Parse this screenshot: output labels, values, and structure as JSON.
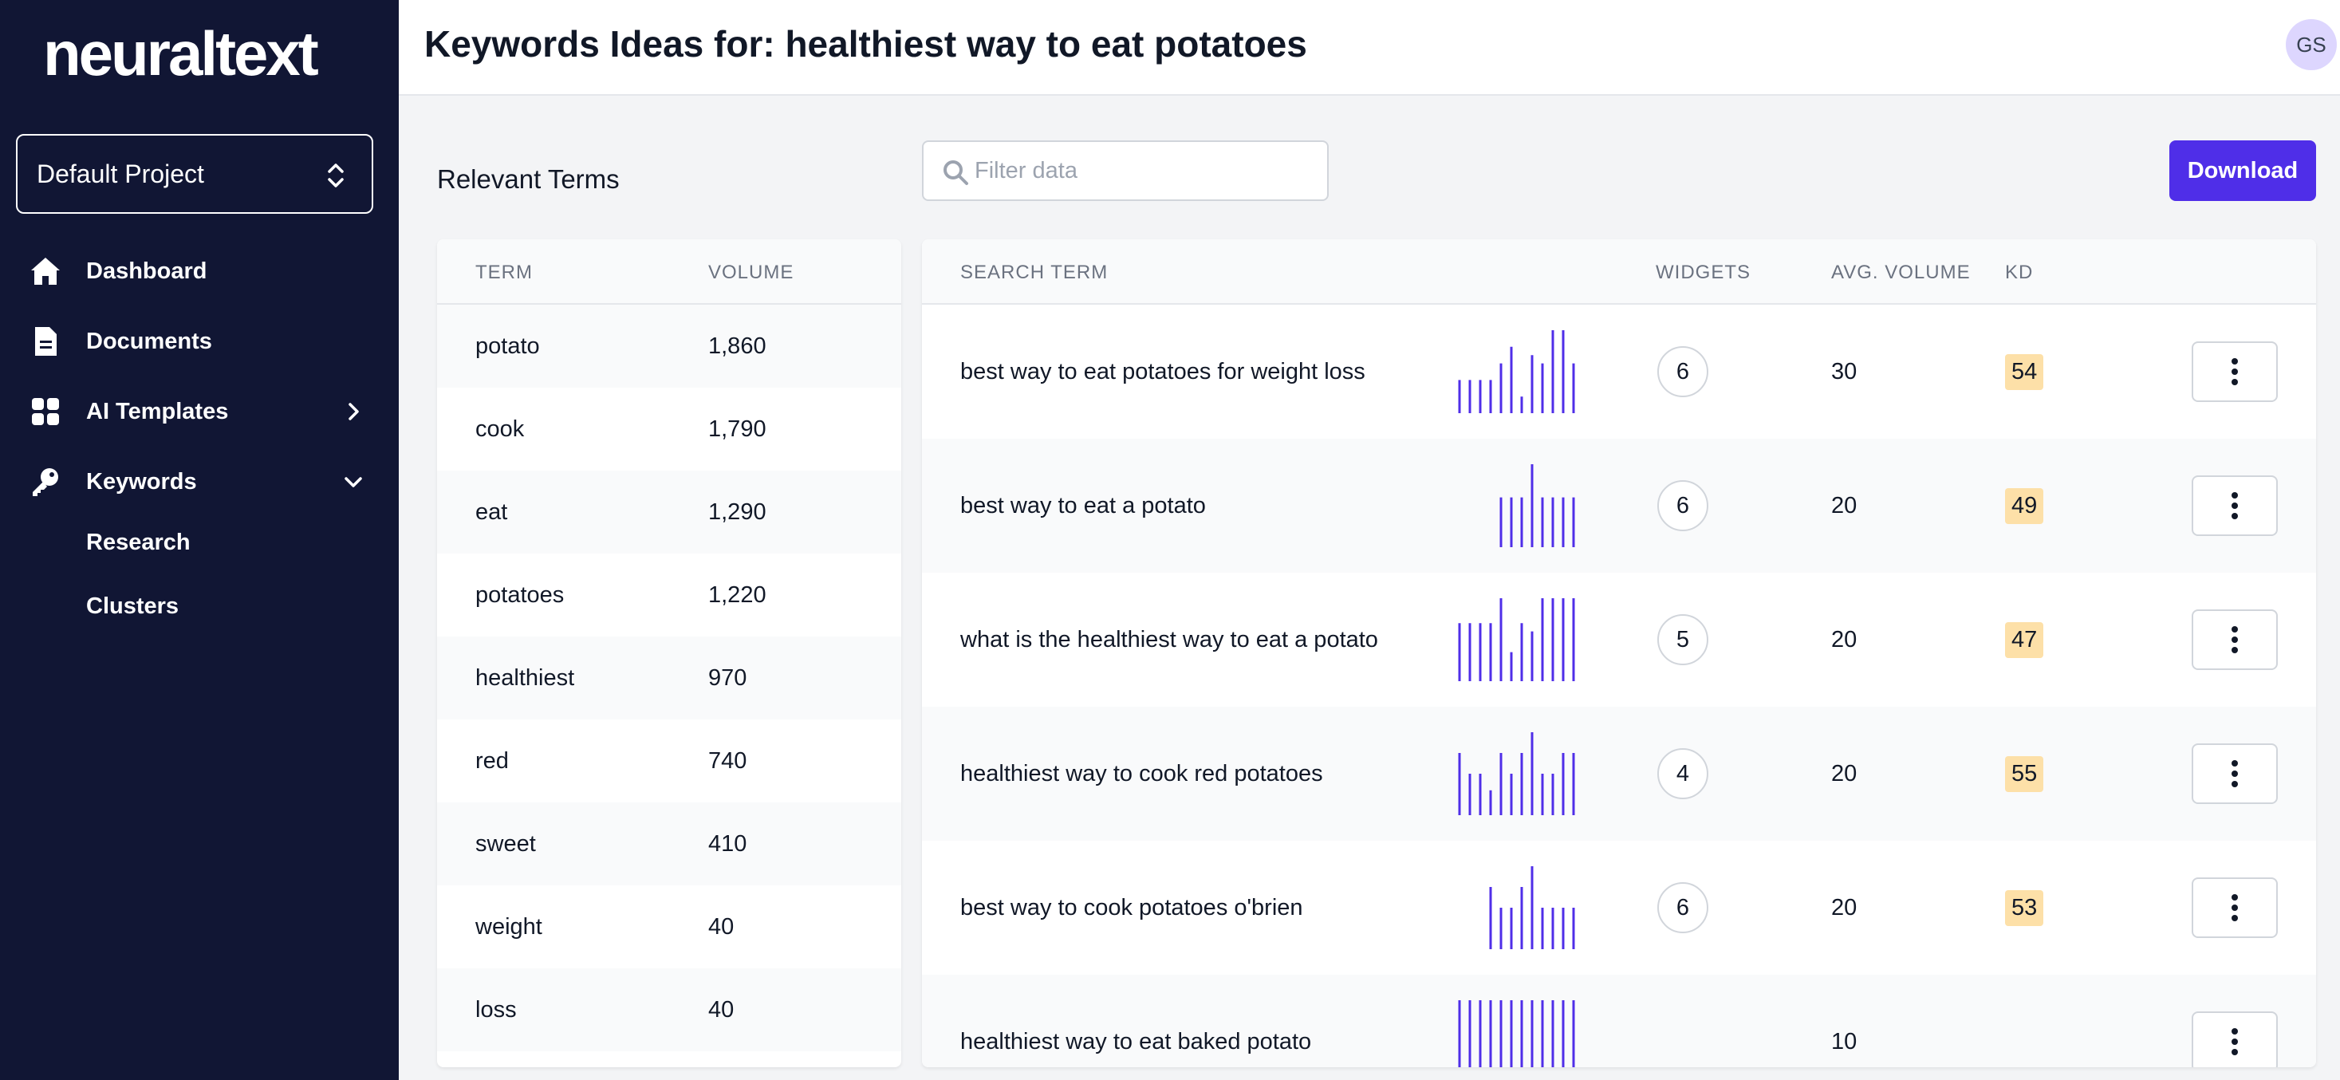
{
  "app": {
    "logo": "neuraltext",
    "title_prefix": "Keywords Ideas for: healthiest way to eat potatoes",
    "avatar_initials": "GS"
  },
  "sidebar": {
    "project": "Default Project",
    "items": [
      {
        "label": "Dashboard",
        "icon": "home-icon"
      },
      {
        "label": "Documents",
        "icon": "document-icon"
      },
      {
        "label": "AI Templates",
        "icon": "grid-icon"
      },
      {
        "label": "Keywords",
        "icon": "key-icon"
      }
    ],
    "sub_items": [
      {
        "label": "Research"
      },
      {
        "label": "Clusters"
      }
    ]
  },
  "toolbar": {
    "section_label": "Relevant Terms",
    "filter_placeholder": "Filter data",
    "download_label": "Download"
  },
  "terms_table": {
    "headers": {
      "term": "TERM",
      "volume": "VOLUME"
    },
    "rows": [
      {
        "term": "potato",
        "volume": "1,860"
      },
      {
        "term": "cook",
        "volume": "1,790"
      },
      {
        "term": "eat",
        "volume": "1,290"
      },
      {
        "term": "potatoes",
        "volume": "1,220"
      },
      {
        "term": "healthiest",
        "volume": "970"
      },
      {
        "term": "red",
        "volume": "740"
      },
      {
        "term": "sweet",
        "volume": "410"
      },
      {
        "term": "weight",
        "volume": "40"
      },
      {
        "term": "loss",
        "volume": "40"
      }
    ]
  },
  "keywords_table": {
    "headers": {
      "search_term": "SEARCH TERM",
      "widgets": "WIDGETS",
      "avg_volume": "AVG. VOLUME",
      "kd": "KD"
    },
    "rows": [
      {
        "term": "best way to eat potatoes for weight loss",
        "widgets": "6",
        "avg_volume": "30",
        "kd": "54",
        "trend": [
          0.4,
          0.4,
          0.4,
          0.4,
          0.6,
          0.8,
          0.2,
          0.7,
          0.6,
          1.0,
          1.0,
          0.6
        ]
      },
      {
        "term": "best way to eat a potato",
        "widgets": "6",
        "avg_volume": "20",
        "kd": "49",
        "trend": [
          0,
          0,
          0,
          0,
          0.6,
          0.6,
          0.6,
          1.0,
          0.6,
          0.6,
          0.6,
          0.6
        ]
      },
      {
        "term": "what is the healthiest way to eat a potato",
        "widgets": "5",
        "avg_volume": "20",
        "kd": "47",
        "trend": [
          0.7,
          0.7,
          0.7,
          0.7,
          1.0,
          0.35,
          0.7,
          0.6,
          1.0,
          1.0,
          1.0,
          1.0
        ]
      },
      {
        "term": "healthiest way to cook red potatoes",
        "widgets": "4",
        "avg_volume": "20",
        "kd": "55",
        "trend": [
          0.75,
          0.5,
          0.5,
          0.3,
          0.75,
          0.5,
          0.75,
          1.0,
          0.5,
          0.5,
          0.75,
          0.75
        ]
      },
      {
        "term": "best way to cook potatoes o'brien",
        "widgets": "6",
        "avg_volume": "20",
        "kd": "53",
        "trend": [
          0,
          0,
          0,
          0.75,
          0.5,
          0.5,
          0.75,
          1.0,
          0.5,
          0.5,
          0.5,
          0.5
        ]
      },
      {
        "term": "healthiest way to eat baked potato",
        "widgets": "",
        "avg_volume": "10",
        "kd": "",
        "trend": [
          1.0,
          1.0,
          1.0,
          1.0,
          1.0,
          1.0,
          1.0,
          1.0,
          1.0,
          1.0,
          1.0,
          1.0
        ]
      }
    ]
  },
  "colors": {
    "sidebar_bg": "#111634",
    "accent": "#4f2ee8",
    "kd_badge": "#fde0a8",
    "sparkline": "#4f2ee8"
  }
}
